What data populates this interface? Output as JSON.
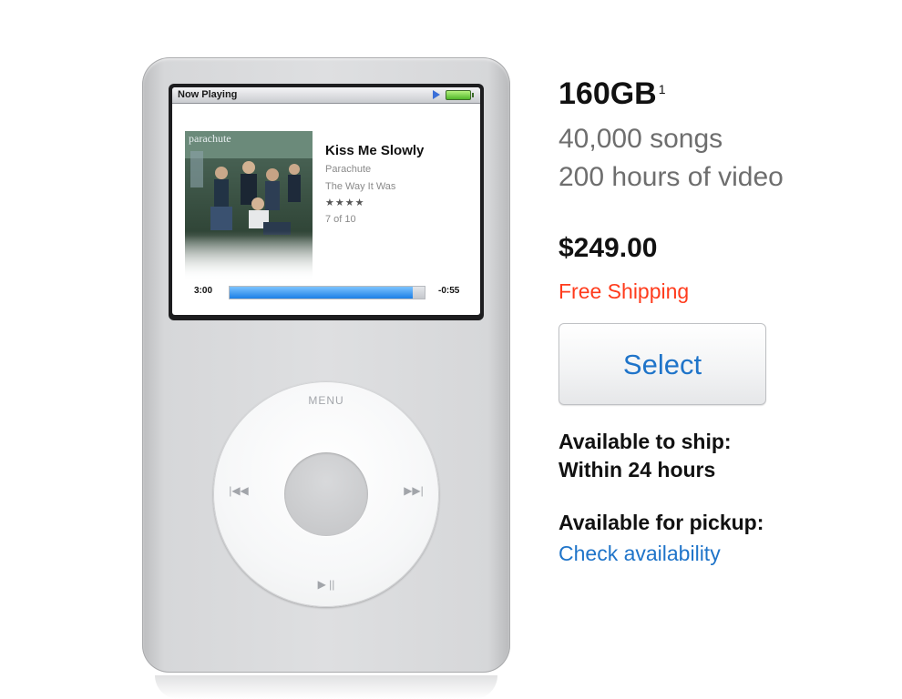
{
  "product_image": {
    "screen": {
      "status_title": "Now Playing",
      "album_art_text": "parachute",
      "track_title": "Kiss Me Slowly",
      "artist": "Parachute",
      "album": "The Way It Was",
      "rating": "★★★★",
      "track_position": "7 of 10",
      "time_elapsed": "3:00",
      "time_remaining": "-0:55",
      "progress_fraction": 0.94
    },
    "wheel": {
      "menu_label": "MENU",
      "prev_glyph": "|◀◀",
      "next_glyph": "▶▶|",
      "play_glyph": "▶ ||"
    }
  },
  "product_info": {
    "capacity": "160GB",
    "footnote": "1",
    "songs": "40,000 songs",
    "video": "200 hours of video",
    "price": "$249.00",
    "shipping": "Free Shipping",
    "select_label": "Select",
    "ship_label": "Available to ship:",
    "ship_value": "Within 24 hours",
    "pickup_label": "Available for pickup:",
    "check_link": "Check availability"
  },
  "colors": {
    "price_text": "#111111",
    "shipping_red": "#ff3b1c",
    "link_blue": "#1f74c9",
    "progress_blue": "#1b7fe6"
  }
}
